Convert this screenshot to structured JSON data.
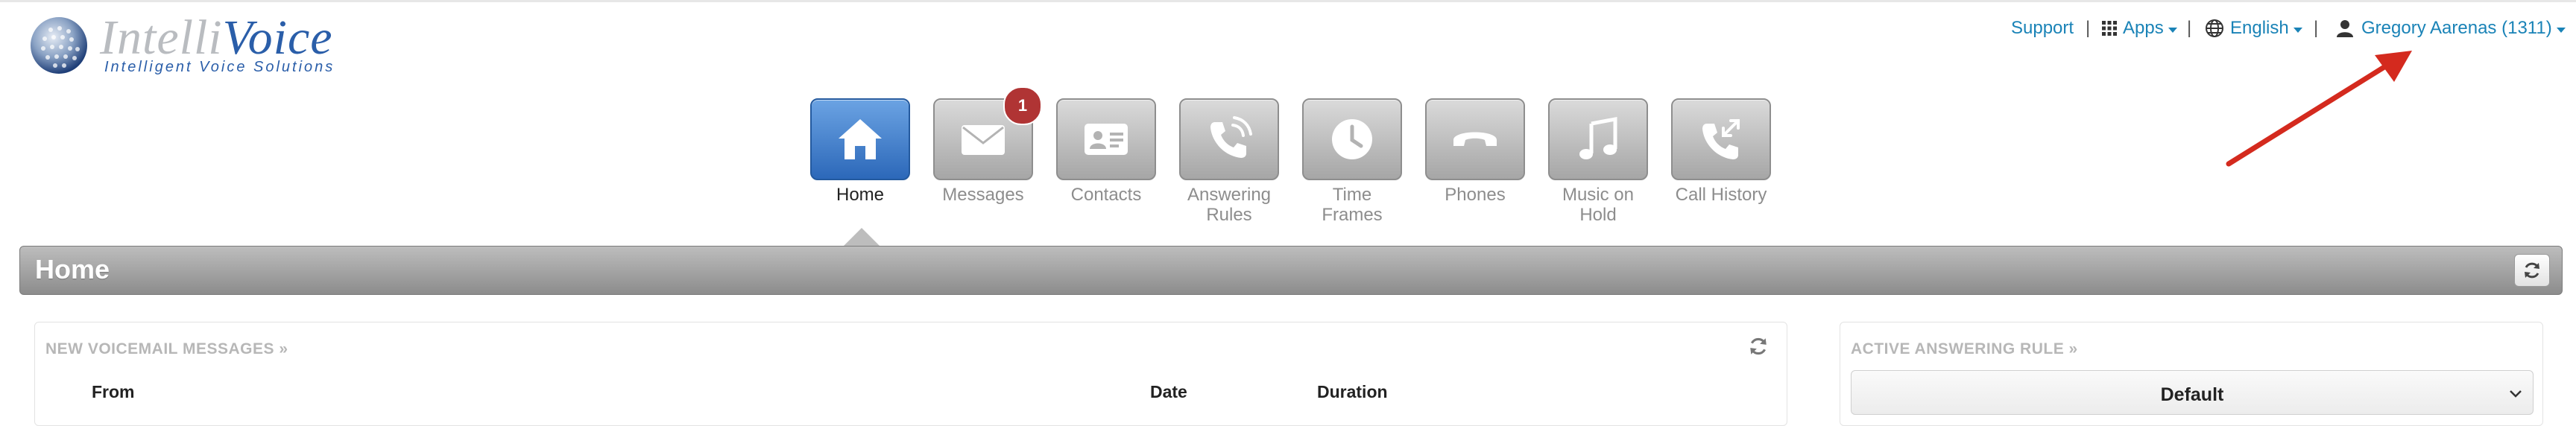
{
  "logo": {
    "word_part1": "Intelli",
    "word_part2": "Voice",
    "tagline": "Intelligent Voice Solutions"
  },
  "usernav": {
    "support": "Support",
    "apps": "Apps",
    "language": "English",
    "user": "Gregory Aarenas (1311)",
    "separator": "|"
  },
  "nav": {
    "items": [
      {
        "label_line1": "Home",
        "label_line2": "",
        "icon": "home-icon",
        "active": true
      },
      {
        "label_line1": "Messages",
        "label_line2": "",
        "icon": "envelope-icon",
        "badge": "1"
      },
      {
        "label_line1": "Contacts",
        "label_line2": "",
        "icon": "contact-card-icon"
      },
      {
        "label_line1": "Answering",
        "label_line2": "Rules",
        "icon": "phone-wave-icon"
      },
      {
        "label_line1": "Time",
        "label_line2": "Frames",
        "icon": "clock-icon"
      },
      {
        "label_line1": "Phones",
        "label_line2": "",
        "icon": "handset-icon"
      },
      {
        "label_line1": "Music on",
        "label_line2": "Hold",
        "icon": "music-note-icon"
      },
      {
        "label_line1": "Call History",
        "label_line2": "",
        "icon": "call-history-icon"
      }
    ]
  },
  "page": {
    "title": "Home"
  },
  "voicemail_panel": {
    "title": "NEW VOICEMAIL MESSAGES »",
    "columns": [
      "From",
      "Date",
      "Duration"
    ]
  },
  "answering_panel": {
    "title": "ACTIVE ANSWERING RULE »",
    "selected": "Default"
  },
  "colors": {
    "link": "#1a83b7",
    "active_tile": "#2c68b9",
    "badge": "#b03434",
    "annotation_arrow": "#d42a1e"
  }
}
